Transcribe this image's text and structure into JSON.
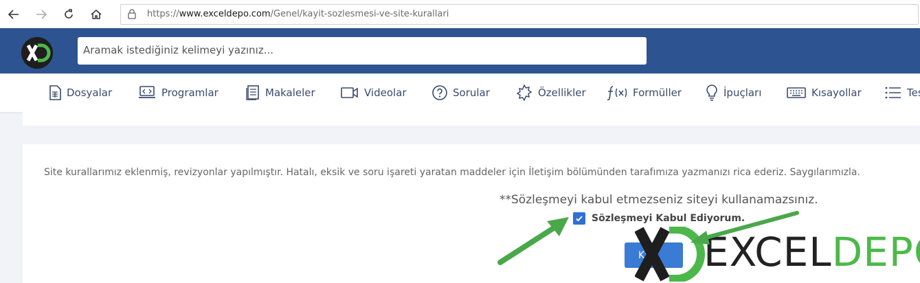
{
  "browser": {
    "url_prefix": "https://",
    "url_host": "www.exceldepo.com",
    "url_path": "/Genel/kayit-sozlesmesi-ve-site-kurallari"
  },
  "header": {
    "search_placeholder": "Aramak istediğiniz kelimeyi yazınız..."
  },
  "nav": {
    "items": [
      {
        "label": "Dosyalar",
        "icon": "spreadsheet-icon"
      },
      {
        "label": "Programlar",
        "icon": "laptop-code-icon"
      },
      {
        "label": "Makaleler",
        "icon": "article-icon"
      },
      {
        "label": "Videolar",
        "icon": "video-icon"
      },
      {
        "label": "Sorular",
        "icon": "question-icon"
      },
      {
        "label": "Özellikler",
        "icon": "badge-icon"
      },
      {
        "label": "Formüller",
        "icon": "function-icon"
      },
      {
        "label": "İpuçları",
        "icon": "lightbulb-icon"
      },
      {
        "label": "Kısayollar",
        "icon": "keyboard-icon"
      },
      {
        "label": "Tes",
        "icon": "list-icon"
      }
    ]
  },
  "content": {
    "notice": "Site kurallarımız eklenmiş, revizyonlar yapılmıştır. Hatalı, eksik ve soru işareti yaratan maddeler için İletişim bölümünden tarafımıza yazmanızı rica ederiz. Saygılarımızla.",
    "warning": "**Sözleşmeyi kabul etmezseniz siteyi kullanamazsınız.",
    "checkbox_label": "Sözleşmeyi Kabul Ediyorum.",
    "checkbox_checked": true,
    "save_button": "Ka"
  },
  "watermark": {
    "excel": "EXCEL",
    "depo": "DEPO"
  },
  "colors": {
    "header_bg": "#2d5490",
    "accent_green": "#4db84a",
    "checkbox_blue": "#2f6fd6",
    "button_blue": "#3a7bd5"
  }
}
